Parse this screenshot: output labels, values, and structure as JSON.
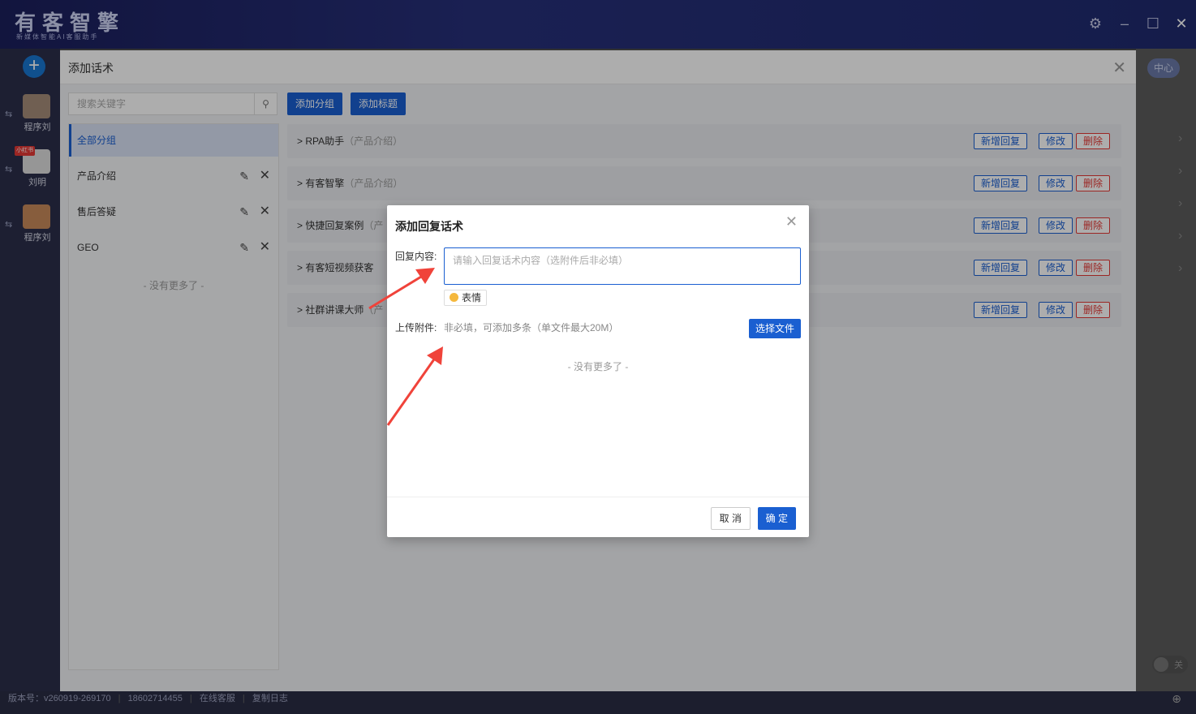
{
  "app": {
    "logo": "有客智擎",
    "logo_sub": "新媒体智能AI客服助手",
    "right_tab": "中心"
  },
  "rail": {
    "add_label": "+",
    "accounts": [
      {
        "name": "程序刘",
        "badge": ""
      },
      {
        "name": "刘明",
        "badge": "小红书"
      },
      {
        "name": "程序刘",
        "badge": ""
      }
    ]
  },
  "footer": {
    "version": "版本号：v260919-269170",
    "phone": "18602714455",
    "service": "在线客服",
    "copy_log": "复制日志"
  },
  "toggle": {
    "label": "关"
  },
  "modal": {
    "title": "添加话术",
    "search_placeholder": "搜索关键字",
    "add_group_label": "添加分组",
    "add_title_label": "添加标题",
    "groups": [
      {
        "label": "全部分组"
      },
      {
        "label": "产品介绍"
      },
      {
        "label": "售后答疑"
      },
      {
        "label": "GEO"
      }
    ],
    "no_more": "- 没有更多了 -",
    "rows": [
      {
        "title": "RPA助手",
        "sub": "（产品介绍）"
      },
      {
        "title": "有客智擎",
        "sub": "（产品介绍）"
      },
      {
        "title": "快捷回复案例",
        "sub": "（产"
      },
      {
        "title": "有客短视频获客",
        "sub": ""
      },
      {
        "title": "社群讲课大师",
        "sub": "（产"
      }
    ],
    "row_buttons": {
      "add_reply": "新增回复",
      "edit": "修改",
      "delete": "删除"
    }
  },
  "dialog": {
    "title": "添加回复话术",
    "content_label": "回复内容:",
    "content_placeholder": "请输入回复话术内容（选附件后非必填）",
    "emoji_label": "表情",
    "upload_label": "上传附件:",
    "upload_hint": "非必填，可添加多条（单文件最大20M）",
    "select_file": "选择文件",
    "no_more": "- 没有更多了 -",
    "cancel": "取 消",
    "ok": "确 定"
  },
  "colors": {
    "accent": "#1a5fd1",
    "danger": "#e53935",
    "arrow": "#f0433a"
  }
}
